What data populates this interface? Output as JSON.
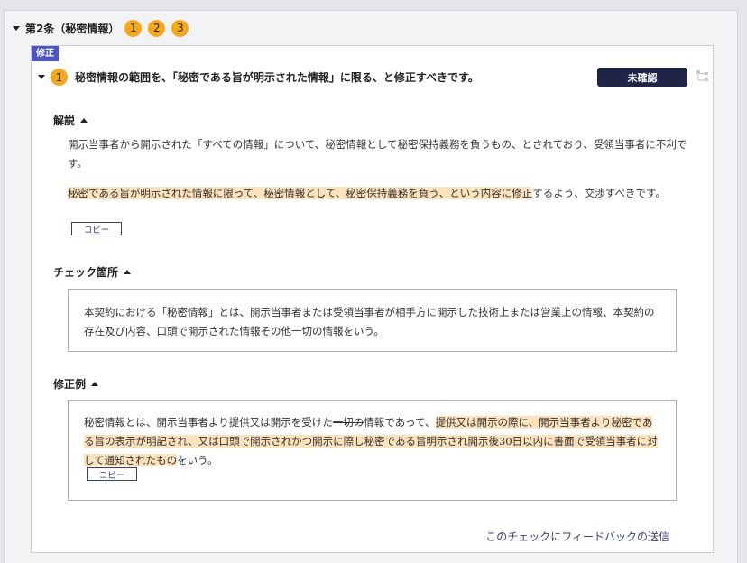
{
  "article": {
    "title": "第2条（秘密情報）",
    "badges": [
      "1",
      "2",
      "3"
    ]
  },
  "issue": {
    "tag": "修正",
    "number": "1",
    "title": "秘密情報の範囲を、「秘密である旨が明示された情報」に限る、と修正すべきです。",
    "status": "未確認"
  },
  "explanation": {
    "label": "解説",
    "paragraph1": "開示当事者から開示された「すべての情報」について、秘密情報として秘密保持義務を負うもの、とされており、受領当事者に不利です。",
    "paragraph2_highlight": "秘密である旨が明示された情報に限って、秘密情報として、秘密保持義務を負う、という内容に修正",
    "paragraph2_rest": "するよう、交渉すべきです。",
    "copy_label": "コピー"
  },
  "check": {
    "label": "チェック箇所",
    "text": "本契約における「秘密情報」とは、開示当事者または受領当事者が相手方に開示した技術上または営業上の情報、本契約の存在及び内容、口頭で開示された情報その他一切の情報をいう。"
  },
  "example": {
    "label": "修正例",
    "text_pre": "秘密情報とは、開示当事者より提供又は開示を受けた",
    "text_struck": "一切の",
    "text_mid": "情報であって、",
    "text_highlight": "提供又は開示の際に、開示当事者より秘密である旨の表示が明記され、又は口頭で開示されかつ開示に際し秘密である旨明示され開示後30日以内に書面で受領当事者に対して通知されたもの",
    "text_post": "をいう。",
    "copy_label": "コピー"
  },
  "feedback": {
    "label": "このチェックにフィードバックの送信"
  },
  "colors": {
    "badge": "#f5a81c",
    "tag": "#4b55c7",
    "status_bg": "#1f2547",
    "highlight": "#fde2bb",
    "link": "#3a3f7a"
  }
}
